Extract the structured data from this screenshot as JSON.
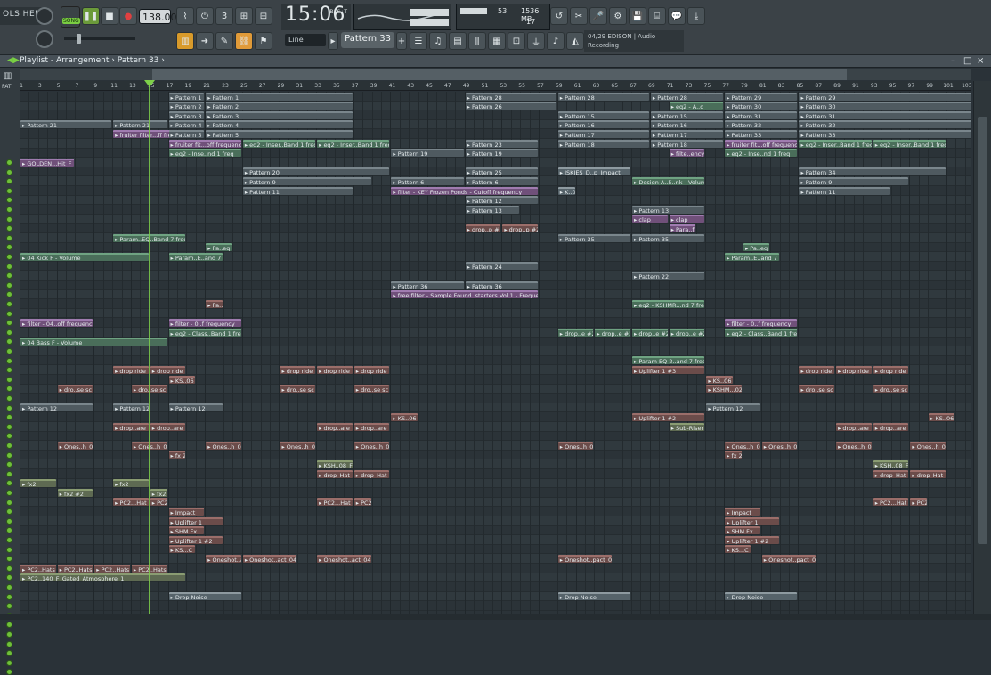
{
  "menu": {
    "label": "OLS  HELP"
  },
  "transport": {
    "song_label": "SONG",
    "tempo": "138.000",
    "time": "15:06",
    "time_unit": "B:S:T"
  },
  "cpu": {
    "value": "53",
    "memory": "1536 MB",
    "polyphony": "17"
  },
  "pattern_selector": {
    "label": "Pattern 33"
  },
  "snap": {
    "label": "Line"
  },
  "hint": {
    "line1": "04/29  EDISON | Audio",
    "line2": "Recording"
  },
  "playlist": {
    "title": "Playlist - Arrangement",
    "breadcrumb": "Pattern 33",
    "pat_label": "PAT"
  },
  "ruler": [
    "1",
    "3",
    "5",
    "7",
    "9",
    "11",
    "13",
    "15",
    "17",
    "19",
    "21",
    "23",
    "25",
    "27",
    "29",
    "31",
    "33",
    "35",
    "37",
    "39",
    "41",
    "43",
    "45",
    "47",
    "49",
    "51",
    "53",
    "55",
    "57",
    "59",
    "61",
    "63",
    "65",
    "67",
    "69",
    "71",
    "73",
    "75",
    "77",
    "79",
    "81",
    "83",
    "85",
    "87",
    "89",
    "91",
    "93",
    "95",
    "97",
    "99",
    "101",
    "103"
  ],
  "clips": [
    {
      "r": 0,
      "b": 17,
      "l": 4,
      "t": "pat",
      "n": "Pattern 1"
    },
    {
      "r": 0,
      "b": 21,
      "l": 16,
      "t": "pat",
      "n": "Pattern 1"
    },
    {
      "r": 0,
      "b": 49,
      "l": 10,
      "t": "pat",
      "n": "Pattern 28"
    },
    {
      "r": 0,
      "b": 59,
      "l": 10,
      "t": "pat",
      "n": "Pattern 28"
    },
    {
      "r": 0,
      "b": 69,
      "l": 8,
      "t": "pat",
      "n": "Pattern 28"
    },
    {
      "r": 0,
      "b": 77,
      "l": 8,
      "t": "pat",
      "n": "Pattern 29"
    },
    {
      "r": 0,
      "b": 85,
      "l": 20,
      "t": "pat",
      "n": "Pattern 29"
    },
    {
      "r": 1,
      "b": 17,
      "l": 4,
      "t": "pat",
      "n": "Pattern 2"
    },
    {
      "r": 1,
      "b": 21,
      "l": 16,
      "t": "pat",
      "n": "Pattern 2"
    },
    {
      "r": 1,
      "b": 49,
      "l": 10,
      "t": "pat",
      "n": "Pattern 26"
    },
    {
      "r": 1,
      "b": 71,
      "l": 6,
      "t": "auto",
      "n": "eq2 - A..q"
    },
    {
      "r": 1,
      "b": 77,
      "l": 8,
      "t": "pat",
      "n": "Pattern 30"
    },
    {
      "r": 1,
      "b": 85,
      "l": 20,
      "t": "pat",
      "n": "Pattern 30"
    },
    {
      "r": 2,
      "b": 17,
      "l": 4,
      "t": "pat",
      "n": "Pattern 3"
    },
    {
      "r": 2,
      "b": 21,
      "l": 16,
      "t": "pat",
      "n": "Pattern 3"
    },
    {
      "r": 2,
      "b": 59,
      "l": 10,
      "t": "pat",
      "n": "Pattern 15"
    },
    {
      "r": 2,
      "b": 69,
      "l": 8,
      "t": "pat",
      "n": "Pattern 15"
    },
    {
      "r": 2,
      "b": 77,
      "l": 8,
      "t": "pat",
      "n": "Pattern 31"
    },
    {
      "r": 2,
      "b": 85,
      "l": 20,
      "t": "pat",
      "n": "Pattern 31"
    },
    {
      "r": 3,
      "b": 1,
      "l": 10,
      "t": "pat",
      "n": "Pattern 21"
    },
    {
      "r": 3,
      "b": 11,
      "l": 6,
      "t": "pat",
      "n": "Pattern 21"
    },
    {
      "r": 3,
      "b": 17,
      "l": 4,
      "t": "pat",
      "n": "Pattern 4"
    },
    {
      "r": 3,
      "b": 21,
      "l": 16,
      "t": "pat",
      "n": "Pattern 4"
    },
    {
      "r": 3,
      "b": 59,
      "l": 10,
      "t": "pat",
      "n": "Pattern 16"
    },
    {
      "r": 3,
      "b": 69,
      "l": 8,
      "t": "pat",
      "n": "Pattern 16"
    },
    {
      "r": 3,
      "b": 77,
      "l": 8,
      "t": "pat",
      "n": "Pattern 32"
    },
    {
      "r": 3,
      "b": 85,
      "l": 20,
      "t": "pat",
      "n": "Pattern 32"
    },
    {
      "r": 4,
      "b": 11,
      "l": 8,
      "t": "automag",
      "n": "fruiter filter...ff frequency"
    },
    {
      "r": 4,
      "b": 17,
      "l": 4,
      "t": "pat",
      "n": "Pattern 5"
    },
    {
      "r": 4,
      "b": 21,
      "l": 16,
      "t": "pat",
      "n": "Pattern 5"
    },
    {
      "r": 4,
      "b": 59,
      "l": 10,
      "t": "pat",
      "n": "Pattern 17"
    },
    {
      "r": 4,
      "b": 69,
      "l": 8,
      "t": "pat",
      "n": "Pattern 17"
    },
    {
      "r": 4,
      "b": 77,
      "l": 8,
      "t": "pat",
      "n": "Pattern 33"
    },
    {
      "r": 4,
      "b": 85,
      "l": 20,
      "t": "pat",
      "n": "Pattern 33"
    },
    {
      "r": 5,
      "b": 17,
      "l": 8,
      "t": "automag",
      "n": "fruiter fit...off frequency"
    },
    {
      "r": 5,
      "b": 25,
      "l": 8,
      "t": "auto",
      "n": "eq2 - Inser..Band 1 freq"
    },
    {
      "r": 5,
      "b": 33,
      "l": 8,
      "t": "auto",
      "n": "eq2 - Inser..Band 1 freq"
    },
    {
      "r": 5,
      "b": 49,
      "l": 8,
      "t": "pat",
      "n": "Pattern 23"
    },
    {
      "r": 5,
      "b": 59,
      "l": 10,
      "t": "pat",
      "n": "Pattern 18"
    },
    {
      "r": 5,
      "b": 69,
      "l": 8,
      "t": "pat",
      "n": "Pattern 18"
    },
    {
      "r": 5,
      "b": 77,
      "l": 8,
      "t": "automag",
      "n": "fruiter fit...off frequency"
    },
    {
      "r": 5,
      "b": 85,
      "l": 8,
      "t": "auto",
      "n": "eq2 - Inser..Band 1 freq"
    },
    {
      "r": 5,
      "b": 93,
      "l": 8,
      "t": "auto",
      "n": "eq2 - Inser..Band 1 freq"
    },
    {
      "r": 6,
      "b": 17,
      "l": 8,
      "t": "auto",
      "n": "eq2 - Inse..nd 1 freq"
    },
    {
      "r": 6,
      "b": 41,
      "l": 8,
      "t": "pat",
      "n": "Pattern 19"
    },
    {
      "r": 6,
      "b": 49,
      "l": 8,
      "t": "pat",
      "n": "Pattern 19"
    },
    {
      "r": 6,
      "b": 71,
      "l": 4,
      "t": "automag",
      "n": "filte..ency"
    },
    {
      "r": 6,
      "b": 77,
      "l": 8,
      "t": "auto",
      "n": "eq2 - Inse..nd 1 freq"
    },
    {
      "r": 7,
      "b": 1,
      "l": 6,
      "t": "automag",
      "n": "GOLDEN...Hit_F"
    },
    {
      "r": 8,
      "b": 25,
      "l": 16,
      "t": "pat",
      "n": "Pattern 20"
    },
    {
      "r": 8,
      "b": 49,
      "l": 8,
      "t": "pat",
      "n": "Pattern 25"
    },
    {
      "r": 8,
      "b": 59,
      "l": 8,
      "t": "blk",
      "n": "JSKIES_D..p_Impact"
    },
    {
      "r": 8,
      "b": 85,
      "l": 16,
      "t": "pat",
      "n": "Pattern 34"
    },
    {
      "r": 9,
      "b": 25,
      "l": 14,
      "t": "pat",
      "n": "Pattern 9"
    },
    {
      "r": 9,
      "b": 41,
      "l": 8,
      "t": "pat",
      "n": "Pattern 6"
    },
    {
      "r": 9,
      "b": 49,
      "l": 8,
      "t": "pat",
      "n": "Pattern 6"
    },
    {
      "r": 9,
      "b": 67,
      "l": 8,
      "t": "auto",
      "n": "Design A..5..nk - Volume"
    },
    {
      "r": 9,
      "b": 85,
      "l": 12,
      "t": "pat",
      "n": "Pattern 9"
    },
    {
      "r": 10,
      "b": 25,
      "l": 12,
      "t": "pat",
      "n": "Pattern 11"
    },
    {
      "r": 10,
      "b": 41,
      "l": 16,
      "t": "automag",
      "n": "filter - KEY Frozen Ponds - Cutoff frequency"
    },
    {
      "r": 10,
      "b": 59,
      "l": 2,
      "t": "blk",
      "n": "K..01"
    },
    {
      "r": 10,
      "b": 85,
      "l": 10,
      "t": "pat",
      "n": "Pattern 11"
    },
    {
      "r": 11,
      "b": 49,
      "l": 8,
      "t": "pat",
      "n": "Pattern 12"
    },
    {
      "r": 12,
      "b": 49,
      "l": 6,
      "t": "pat",
      "n": "Pattern 13"
    },
    {
      "r": 12,
      "b": 67,
      "l": 8,
      "t": "pat",
      "n": "Pattern 13"
    },
    {
      "r": 13,
      "b": 67,
      "l": 4,
      "t": "automag",
      "n": "clap"
    },
    {
      "r": 13,
      "b": 71,
      "l": 4,
      "t": "automag",
      "n": "clap"
    },
    {
      "r": 14,
      "b": 49,
      "l": 4,
      "t": "audio",
      "n": "drop..p #2"
    },
    {
      "r": 14,
      "b": 53,
      "l": 4,
      "t": "audio",
      "n": "drop..p #2"
    },
    {
      "r": 14,
      "b": 71,
      "l": 3,
      "t": "automag",
      "n": "Para..freq"
    },
    {
      "r": 15,
      "b": 11,
      "l": 8,
      "t": "auto",
      "n": "Param..EQ..Band 7 freq"
    },
    {
      "r": 15,
      "b": 59,
      "l": 8,
      "t": "pat",
      "n": "Pattern 35"
    },
    {
      "r": 15,
      "b": 67,
      "l": 8,
      "t": "pat",
      "n": "Pattern 35"
    },
    {
      "r": 16,
      "b": 21,
      "l": 3,
      "t": "auto",
      "n": "Pa..eq"
    },
    {
      "r": 16,
      "b": 79,
      "l": 3,
      "t": "auto",
      "n": "Pa..eq"
    },
    {
      "r": 17,
      "b": 1,
      "l": 14,
      "t": "auto",
      "n": "04 Kick F - Volume"
    },
    {
      "r": 17,
      "b": 17,
      "l": 6,
      "t": "auto",
      "n": "Param..E..and 7 freq"
    },
    {
      "r": 17,
      "b": 77,
      "l": 6,
      "t": "auto",
      "n": "Param..E..and 7 freq"
    },
    {
      "r": 18,
      "b": 49,
      "l": 8,
      "t": "pat",
      "n": "Pattern 24"
    },
    {
      "r": 19,
      "b": 67,
      "l": 8,
      "t": "pat",
      "n": "Pattern 22"
    },
    {
      "r": 20,
      "b": 41,
      "l": 8,
      "t": "pat",
      "n": "Pattern 36"
    },
    {
      "r": 20,
      "b": 49,
      "l": 8,
      "t": "pat",
      "n": "Pattern 36"
    },
    {
      "r": 21,
      "b": 41,
      "l": 16,
      "t": "automag",
      "n": "free filter - Sample Found..starters Vol 1 - Frequency"
    },
    {
      "r": 22,
      "b": 21,
      "l": 2,
      "t": "audio",
      "n": "Pa..8"
    },
    {
      "r": 22,
      "b": 67,
      "l": 8,
      "t": "auto",
      "n": "eq2 - KSHMR...nd 7 freq"
    },
    {
      "r": 24,
      "b": 1,
      "l": 8,
      "t": "automag",
      "n": "filter - 04..off frequency"
    },
    {
      "r": 24,
      "b": 17,
      "l": 8,
      "t": "automag",
      "n": "filter - 0..f frequency"
    },
    {
      "r": 24,
      "b": 77,
      "l": 8,
      "t": "automag",
      "n": "filter - 0..f frequency"
    },
    {
      "r": 25,
      "b": 17,
      "l": 8,
      "t": "auto",
      "n": "eq2 - Class..Band 1 freq"
    },
    {
      "r": 25,
      "b": 59,
      "l": 4,
      "t": "auto",
      "n": "drop..e #2"
    },
    {
      "r": 25,
      "b": 63,
      "l": 4,
      "t": "auto",
      "n": "drop..e #2"
    },
    {
      "r": 25,
      "b": 67,
      "l": 4,
      "t": "auto",
      "n": "drop..e #2"
    },
    {
      "r": 25,
      "b": 71,
      "l": 4,
      "t": "auto",
      "n": "drop..e #2"
    },
    {
      "r": 25,
      "b": 77,
      "l": 8,
      "t": "auto",
      "n": "eq2 - Class..Band 1 freq"
    },
    {
      "r": 26,
      "b": 1,
      "l": 16,
      "t": "auto",
      "n": "04 Bass F - Volume"
    },
    {
      "r": 28,
      "b": 67,
      "l": 8,
      "t": "auto",
      "n": "Param EQ 2..and 7 freq"
    },
    {
      "r": 29,
      "b": 11,
      "l": 4,
      "t": "audio",
      "n": "drop ride"
    },
    {
      "r": 29,
      "b": 15,
      "l": 4,
      "t": "audio",
      "n": "drop ride"
    },
    {
      "r": 29,
      "b": 29,
      "l": 4,
      "t": "audio",
      "n": "drop ride"
    },
    {
      "r": 29,
      "b": 33,
      "l": 4,
      "t": "audio",
      "n": "drop ride"
    },
    {
      "r": 29,
      "b": 37,
      "l": 4,
      "t": "audio",
      "n": "drop ride"
    },
    {
      "r": 29,
      "b": 67,
      "l": 8,
      "t": "audio",
      "n": "Uplifter 1 #3"
    },
    {
      "r": 29,
      "b": 85,
      "l": 4,
      "t": "audio",
      "n": "drop ride"
    },
    {
      "r": 29,
      "b": 89,
      "l": 4,
      "t": "audio",
      "n": "drop ride"
    },
    {
      "r": 29,
      "b": 93,
      "l": 4,
      "t": "audio",
      "n": "drop ride"
    },
    {
      "r": 30,
      "b": 17,
      "l": 3,
      "t": "audio",
      "n": "KS..06"
    },
    {
      "r": 30,
      "b": 75,
      "l": 3,
      "t": "audio",
      "n": "KS..06"
    },
    {
      "r": 31,
      "b": 5,
      "l": 4,
      "t": "audio",
      "n": "dro..se sc"
    },
    {
      "r": 31,
      "b": 13,
      "l": 4,
      "t": "audio",
      "n": "dro..se sc"
    },
    {
      "r": 31,
      "b": 29,
      "l": 4,
      "t": "audio",
      "n": "dro..se sc"
    },
    {
      "r": 31,
      "b": 37,
      "l": 4,
      "t": "audio",
      "n": "dro..se sc"
    },
    {
      "r": 31,
      "b": 75,
      "l": 4,
      "t": "audio",
      "n": "KSHM...02"
    },
    {
      "r": 31,
      "b": 85,
      "l": 4,
      "t": "audio",
      "n": "dro..se sc"
    },
    {
      "r": 31,
      "b": 93,
      "l": 4,
      "t": "audio",
      "n": "dro..se sc"
    },
    {
      "r": 33,
      "b": 1,
      "l": 8,
      "t": "pat",
      "n": "Pattern 12"
    },
    {
      "r": 33,
      "b": 11,
      "l": 4,
      "t": "pat",
      "n": "Pattern 12"
    },
    {
      "r": 33,
      "b": 17,
      "l": 6,
      "t": "pat",
      "n": "Pattern 12"
    },
    {
      "r": 33,
      "b": 75,
      "l": 6,
      "t": "pat",
      "n": "Pattern 12"
    },
    {
      "r": 34,
      "b": 41,
      "l": 3,
      "t": "audio",
      "n": "KS..06"
    },
    {
      "r": 34,
      "b": 67,
      "l": 8,
      "t": "audio",
      "n": "Uplifter 1 #2"
    },
    {
      "r": 34,
      "b": 99,
      "l": 3,
      "t": "audio",
      "n": "KS..06"
    },
    {
      "r": 35,
      "b": 11,
      "l": 4,
      "t": "audio",
      "n": "drop..are"
    },
    {
      "r": 35,
      "b": 15,
      "l": 4,
      "t": "audio",
      "n": "drop..are"
    },
    {
      "r": 35,
      "b": 33,
      "l": 4,
      "t": "audio",
      "n": "drop..are"
    },
    {
      "r": 35,
      "b": 37,
      "l": 4,
      "t": "audio",
      "n": "drop..are"
    },
    {
      "r": 35,
      "b": 71,
      "l": 4,
      "t": "aud2",
      "n": "Sub-Riser"
    },
    {
      "r": 35,
      "b": 89,
      "l": 4,
      "t": "audio",
      "n": "drop..are"
    },
    {
      "r": 35,
      "b": 93,
      "l": 4,
      "t": "audio",
      "n": "drop..are"
    },
    {
      "r": 37,
      "b": 5,
      "l": 4,
      "t": "audio",
      "n": "Ones..h_09"
    },
    {
      "r": 37,
      "b": 13,
      "l": 4,
      "t": "audio",
      "n": "Ones..h_0"
    },
    {
      "r": 37,
      "b": 21,
      "l": 4,
      "t": "audio",
      "n": "Ones..h_09"
    },
    {
      "r": 37,
      "b": 29,
      "l": 4,
      "t": "audio",
      "n": "Ones..h_09"
    },
    {
      "r": 37,
      "b": 37,
      "l": 4,
      "t": "audio",
      "n": "Ones..h_09"
    },
    {
      "r": 37,
      "b": 59,
      "l": 4,
      "t": "audio",
      "n": "Ones..h_09"
    },
    {
      "r": 37,
      "b": 77,
      "l": 4,
      "t": "audio",
      "n": "Ones..h_0"
    },
    {
      "r": 37,
      "b": 81,
      "l": 4,
      "t": "audio",
      "n": "Ones..h_09"
    },
    {
      "r": 37,
      "b": 89,
      "l": 4,
      "t": "audio",
      "n": "Ones..h_09"
    },
    {
      "r": 37,
      "b": 97,
      "l": 4,
      "t": "audio",
      "n": "Ones..h_09"
    },
    {
      "r": 38,
      "b": 17,
      "l": 2,
      "t": "audio",
      "n": "fx 2"
    },
    {
      "r": 38,
      "b": 77,
      "l": 2,
      "t": "audio",
      "n": "fx 2"
    },
    {
      "r": 39,
      "b": 33,
      "l": 4,
      "t": "aud2",
      "n": "KSH..08_F"
    },
    {
      "r": 39,
      "b": 93,
      "l": 4,
      "t": "aud2",
      "n": "KSH..08_F"
    },
    {
      "r": 40,
      "b": 33,
      "l": 4,
      "t": "audio",
      "n": "drop_Hat"
    },
    {
      "r": 40,
      "b": 37,
      "l": 4,
      "t": "audio",
      "n": "drop_Hat"
    },
    {
      "r": 40,
      "b": 93,
      "l": 4,
      "t": "audio",
      "n": "drop_Hat"
    },
    {
      "r": 40,
      "b": 97,
      "l": 4,
      "t": "audio",
      "n": "drop_Hat"
    },
    {
      "r": 41,
      "b": 1,
      "l": 4,
      "t": "aud2",
      "n": "fx2"
    },
    {
      "r": 41,
      "b": 11,
      "l": 4,
      "t": "aud2",
      "n": "fx2"
    },
    {
      "r": 42,
      "b": 5,
      "l": 4,
      "t": "aud2",
      "n": "fx2 #2"
    },
    {
      "r": 42,
      "b": 15,
      "l": 2,
      "t": "aud2",
      "n": "fx2 #2"
    },
    {
      "r": 43,
      "b": 11,
      "l": 4,
      "t": "audio",
      "n": "PC2...Hat"
    },
    {
      "r": 43,
      "b": 15,
      "l": 2,
      "t": "audio",
      "n": "PC2..at"
    },
    {
      "r": 43,
      "b": 33,
      "l": 4,
      "t": "audio",
      "n": "PC2...Hat"
    },
    {
      "r": 43,
      "b": 37,
      "l": 2,
      "t": "audio",
      "n": "PC2..at"
    },
    {
      "r": 43,
      "b": 93,
      "l": 4,
      "t": "audio",
      "n": "PC2...Hat"
    },
    {
      "r": 43,
      "b": 97,
      "l": 2,
      "t": "audio",
      "n": "PC2..at"
    },
    {
      "r": 44,
      "b": 17,
      "l": 4,
      "t": "audio",
      "n": "Impact"
    },
    {
      "r": 44,
      "b": 77,
      "l": 4,
      "t": "audio",
      "n": "Impact"
    },
    {
      "r": 45,
      "b": 17,
      "l": 6,
      "t": "audio",
      "n": "Uplifter 1"
    },
    {
      "r": 45,
      "b": 77,
      "l": 6,
      "t": "audio",
      "n": "Uplifter 1"
    },
    {
      "r": 46,
      "b": 17,
      "l": 4,
      "t": "audio",
      "n": "SHM Fx"
    },
    {
      "r": 46,
      "b": 77,
      "l": 4,
      "t": "audio",
      "n": "SHM Fx"
    },
    {
      "r": 47,
      "b": 17,
      "l": 6,
      "t": "audio",
      "n": "Uplifter 1 #2"
    },
    {
      "r": 47,
      "b": 77,
      "l": 6,
      "t": "audio",
      "n": "Uplifter 1 #2"
    },
    {
      "r": 48,
      "b": 17,
      "l": 3,
      "t": "audio",
      "n": "KS...C"
    },
    {
      "r": 48,
      "b": 77,
      "l": 3,
      "t": "audio",
      "n": "KS...C"
    },
    {
      "r": 49,
      "b": 21,
      "l": 4,
      "t": "audio",
      "n": "Oneshot..a"
    },
    {
      "r": 49,
      "b": 25,
      "l": 6,
      "t": "audio",
      "n": "Oneshot..act_04"
    },
    {
      "r": 49,
      "b": 33,
      "l": 6,
      "t": "audio",
      "n": "Oneshot..act_04"
    },
    {
      "r": 49,
      "b": 59,
      "l": 6,
      "t": "audio",
      "n": "Oneshot..pact_04"
    },
    {
      "r": 49,
      "b": 81,
      "l": 6,
      "t": "audio",
      "n": "Oneshot..pact_04"
    },
    {
      "r": 50,
      "b": 1,
      "l": 4,
      "t": "audio",
      "n": "PC2..Hats"
    },
    {
      "r": 50,
      "b": 5,
      "l": 4,
      "t": "audio",
      "n": "PC2..Hats"
    },
    {
      "r": 50,
      "b": 9,
      "l": 4,
      "t": "audio",
      "n": "PC2..Hats"
    },
    {
      "r": 50,
      "b": 13,
      "l": 4,
      "t": "audio",
      "n": "PC2..Hats"
    },
    {
      "r": 51,
      "b": 1,
      "l": 18,
      "t": "aud2",
      "n": "PC2..140_F_Gated_Atmosphere_1"
    },
    {
      "r": 53,
      "b": 17,
      "l": 8,
      "t": "blk",
      "n": "Drop Noise"
    },
    {
      "r": 53,
      "b": 59,
      "l": 8,
      "t": "blk",
      "n": "Drop Noise"
    },
    {
      "r": 53,
      "b": 77,
      "l": 8,
      "t": "blk",
      "n": "Drop Noise"
    }
  ]
}
